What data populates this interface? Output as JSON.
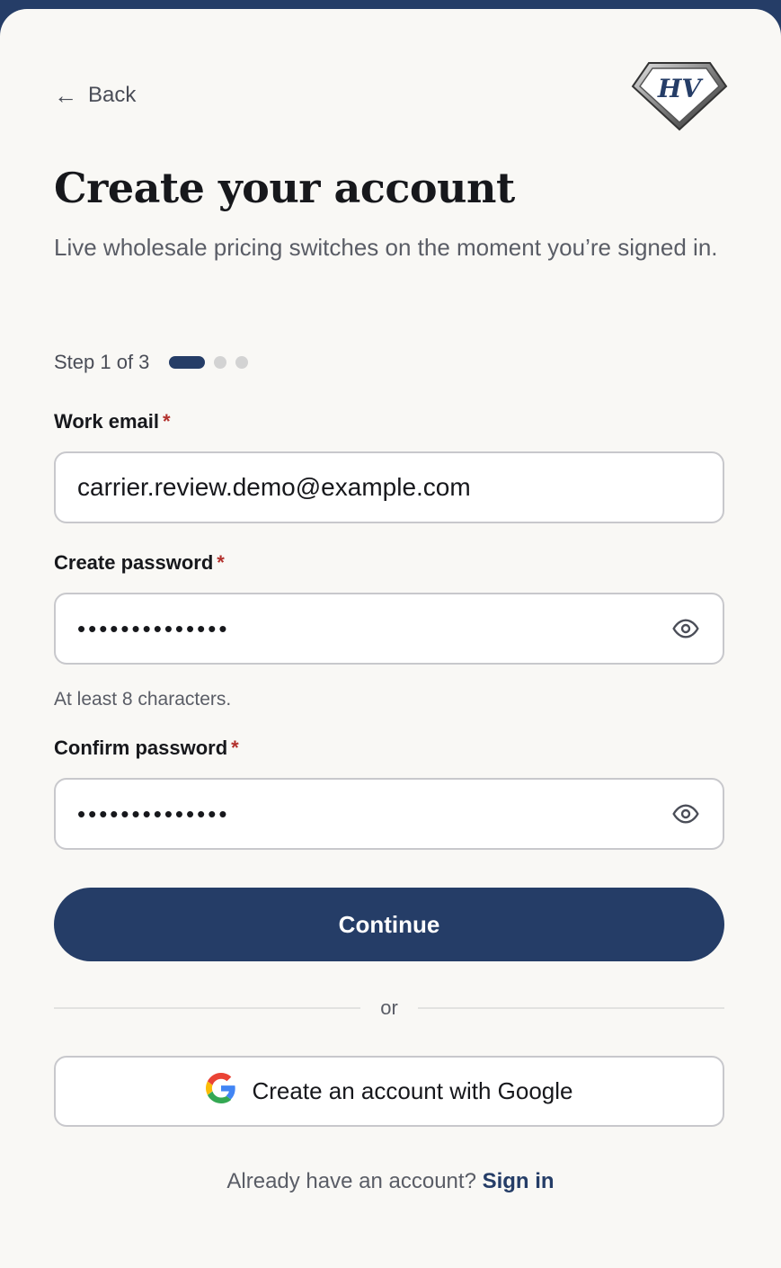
{
  "nav": {
    "back_label": "Back",
    "back_icon": "left-arrow-icon"
  },
  "brand": {
    "logo_text": "HV",
    "logo_icon": "diamond-logo-icon"
  },
  "header": {
    "title": "Create your account",
    "subtitle": "Live wholesale pricing switches on the moment you’re signed in."
  },
  "progress": {
    "text": "Step 1 of 3",
    "current_step": 1,
    "total_steps": 3
  },
  "form": {
    "email": {
      "label": "Work email",
      "required_mark": "*",
      "value": "carrier.review.demo@example.com"
    },
    "password": {
      "label": "Create password",
      "required_mark": "*",
      "value": "••••••••••••••",
      "hint": "At least 8 characters.",
      "toggle_icon": "eye-icon"
    },
    "confirm": {
      "label": "Confirm password",
      "required_mark": "*",
      "value": "••••••••••••••",
      "toggle_icon": "eye-icon"
    },
    "continue_label": "Continue",
    "divider_text": "or",
    "google_label": "Create an account with Google",
    "google_icon": "google-icon"
  },
  "footer": {
    "prompt": "Already have an account?",
    "link": "Sign in"
  },
  "colors": {
    "primary": "#253d67",
    "required": "#b2302c",
    "background": "#f9f8f5"
  }
}
